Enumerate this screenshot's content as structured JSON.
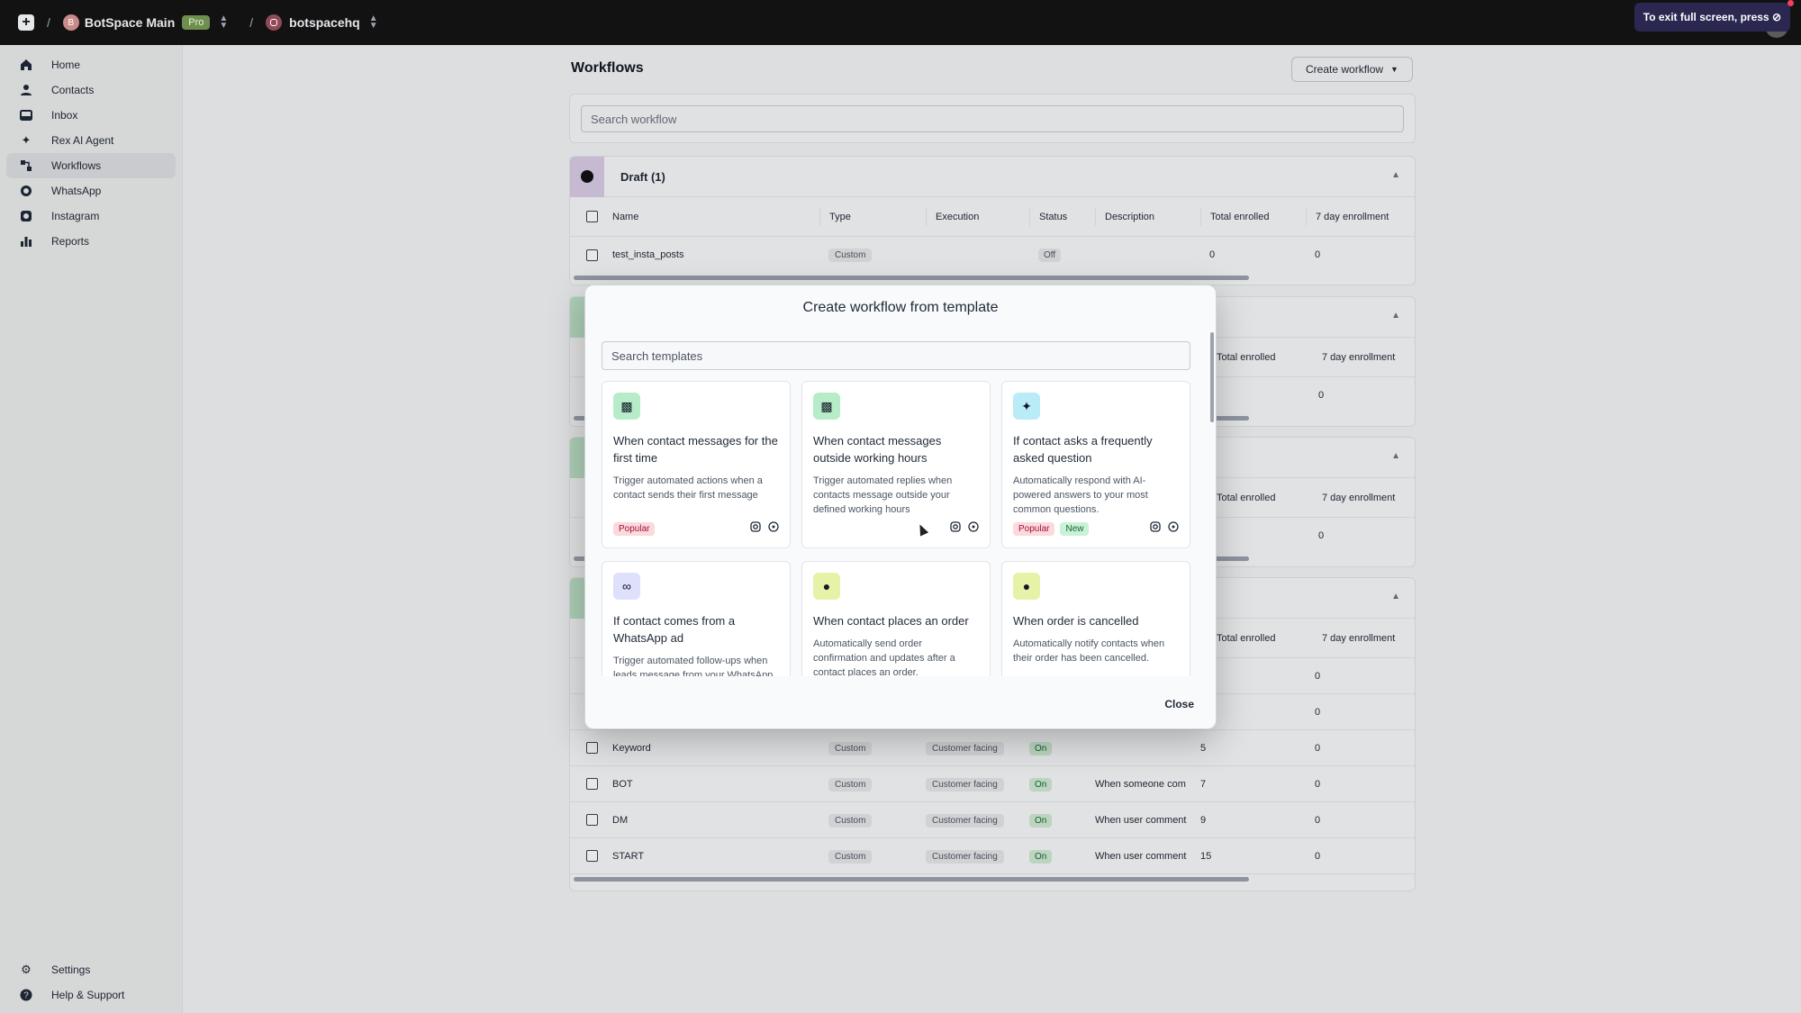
{
  "topbar": {
    "workspace_initial": "B",
    "workspace_name": "BotSpace Main",
    "plan_badge": "Pro",
    "channel_name": "botspacehq",
    "fullscreen_hint": "To exit full screen, press"
  },
  "sidebar": {
    "items": [
      {
        "label": "Home",
        "icon": "home-icon"
      },
      {
        "label": "Contacts",
        "icon": "user-icon"
      },
      {
        "label": "Inbox",
        "icon": "inbox-icon"
      },
      {
        "label": "Rex AI Agent",
        "icon": "sparkle-icon"
      },
      {
        "label": "Workflows",
        "icon": "workflow-icon",
        "active": true
      },
      {
        "label": "WhatsApp",
        "icon": "whatsapp-icon"
      },
      {
        "label": "Instagram",
        "icon": "instagram-icon"
      },
      {
        "label": "Reports",
        "icon": "bar-chart-icon"
      }
    ],
    "bottom": [
      {
        "label": "Settings",
        "icon": "gear-icon"
      },
      {
        "label": "Help & Support",
        "icon": "help-icon"
      }
    ]
  },
  "main": {
    "title": "Workflows",
    "create_button": "Create workflow",
    "search_placeholder": "Search workflow",
    "columns": [
      "Name",
      "Type",
      "Execution",
      "Status",
      "Description",
      "Total enrolled",
      "7 day enrollment"
    ],
    "draft_section": {
      "title": "Draft (1)",
      "rows": [
        {
          "name": "test_insta_posts",
          "type": "Custom",
          "execution": "",
          "status": "Off",
          "description": "",
          "total": "0",
          "seven": "0"
        }
      ]
    },
    "partial_headers": {
      "total": "Total enrolled",
      "seven": "7 day enrollment"
    },
    "hidden_rows_values": [
      {
        "seven": "0"
      },
      {
        "seven": "0"
      },
      {
        "seven": "0"
      }
    ],
    "bottom_rows": [
      {
        "name": "",
        "type": "",
        "execution": "",
        "status": "",
        "description": "",
        "total": "",
        "seven": "0"
      },
      {
        "name": "",
        "type": "",
        "execution": "",
        "status": "",
        "description": "",
        "total": "",
        "seven": "0"
      },
      {
        "name": "Keyword",
        "type": "Custom",
        "execution": "Customer facing",
        "status": "On",
        "description": "",
        "total": "5",
        "seven": "0"
      },
      {
        "name": "BOT",
        "type": "Custom",
        "execution": "Customer facing",
        "status": "On",
        "description": "When someone com",
        "total": "7",
        "seven": "0"
      },
      {
        "name": "DM",
        "type": "Custom",
        "execution": "Customer facing",
        "status": "On",
        "description": "When user comment",
        "total": "9",
        "seven": "0"
      },
      {
        "name": "START",
        "type": "Custom",
        "execution": "Customer facing",
        "status": "On",
        "description": "When user comment",
        "total": "15",
        "seven": "0"
      }
    ]
  },
  "modal": {
    "title": "Create workflow from template",
    "search_placeholder": "Search templates",
    "close_label": "Close",
    "templates": [
      {
        "title": "When contact messages for the first time",
        "desc": "Trigger automated actions when a contact sends their first message",
        "icon": "message-icon",
        "icon_bg": "#b7ecc8",
        "badges": [
          "Popular"
        ],
        "channels": [
          "instagram-icon",
          "whatsapp-icon"
        ]
      },
      {
        "title": "When contact messages outside working hours",
        "desc": "Trigger automated replies when contacts message outside your defined working hours",
        "icon": "message-icon",
        "icon_bg": "#b7ecc8",
        "badges": [],
        "channels": [
          "instagram-icon",
          "whatsapp-icon"
        ]
      },
      {
        "title": "If contact asks a frequently asked question",
        "desc": "Automatically respond with AI-powered answers to your most common questions.",
        "icon": "sparkle-icon",
        "icon_bg": "#b9ecf7",
        "badges": [
          "Popular",
          "New"
        ],
        "channels": [
          "instagram-icon",
          "whatsapp-icon"
        ]
      },
      {
        "title": "If contact comes from a WhatsApp ad",
        "desc": "Trigger automated follow-ups when leads message from your WhatsApp ads",
        "icon": "meta-icon",
        "icon_bg": "#dfe0fb",
        "badges": [],
        "channels": []
      },
      {
        "title": "When contact places an order",
        "desc": "Automatically send order confirmation and updates after a contact places an order.",
        "icon": "shopify-icon",
        "icon_bg": "#e6f2a8",
        "badges": [],
        "channels": []
      },
      {
        "title": "When order is cancelled",
        "desc": "Automatically notify contacts when their order has been cancelled.",
        "icon": "shopify-icon",
        "icon_bg": "#e6f2a8",
        "badges": [],
        "channels": []
      }
    ]
  },
  "colors": {
    "accent_green": "#cfe9d3",
    "popular_badge": "#fbd9dc",
    "new_badge": "#c9f2d6"
  }
}
